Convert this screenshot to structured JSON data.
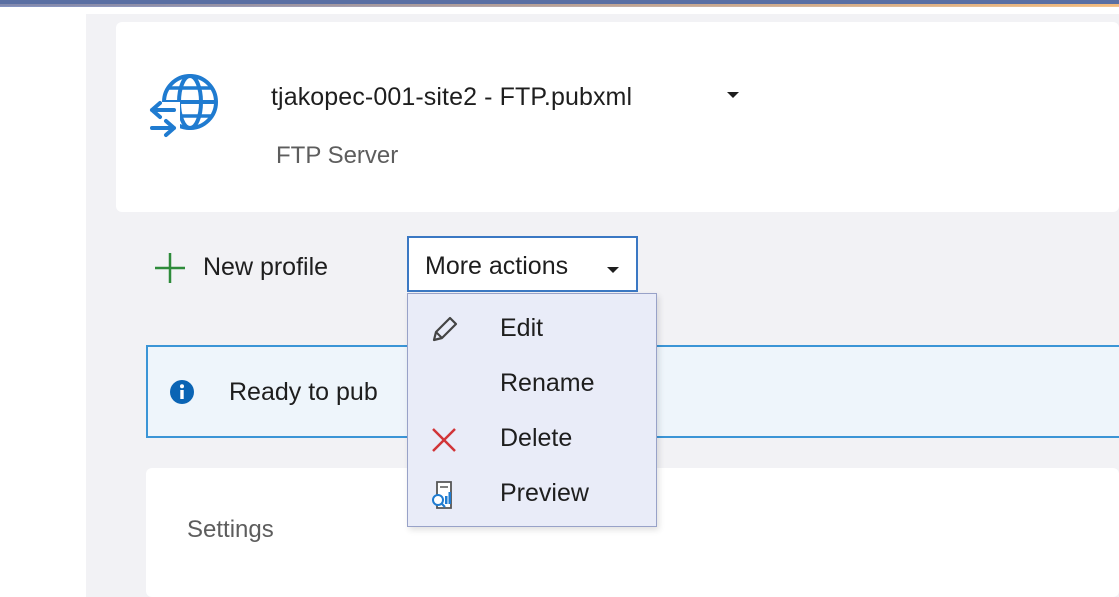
{
  "profile": {
    "name": "tjakopec-001-site2 - FTP.pubxml",
    "type": "FTP Server"
  },
  "toolbar": {
    "new_profile_label": "New profile",
    "more_actions_label": "More actions"
  },
  "dropdown": {
    "items": [
      {
        "label": "Edit",
        "icon": "pencil-icon"
      },
      {
        "label": "Rename",
        "icon": ""
      },
      {
        "label": "Delete",
        "icon": "close-icon"
      },
      {
        "label": "Preview",
        "icon": "preview-icon"
      }
    ]
  },
  "banner": {
    "text": "Ready to pub"
  },
  "settings": {
    "title": "Settings"
  },
  "colors": {
    "accent_blue": "#3b78c3",
    "plus_green": "#2e8b3a",
    "delete_red": "#d13438",
    "info_blue": "#0a64b4"
  }
}
